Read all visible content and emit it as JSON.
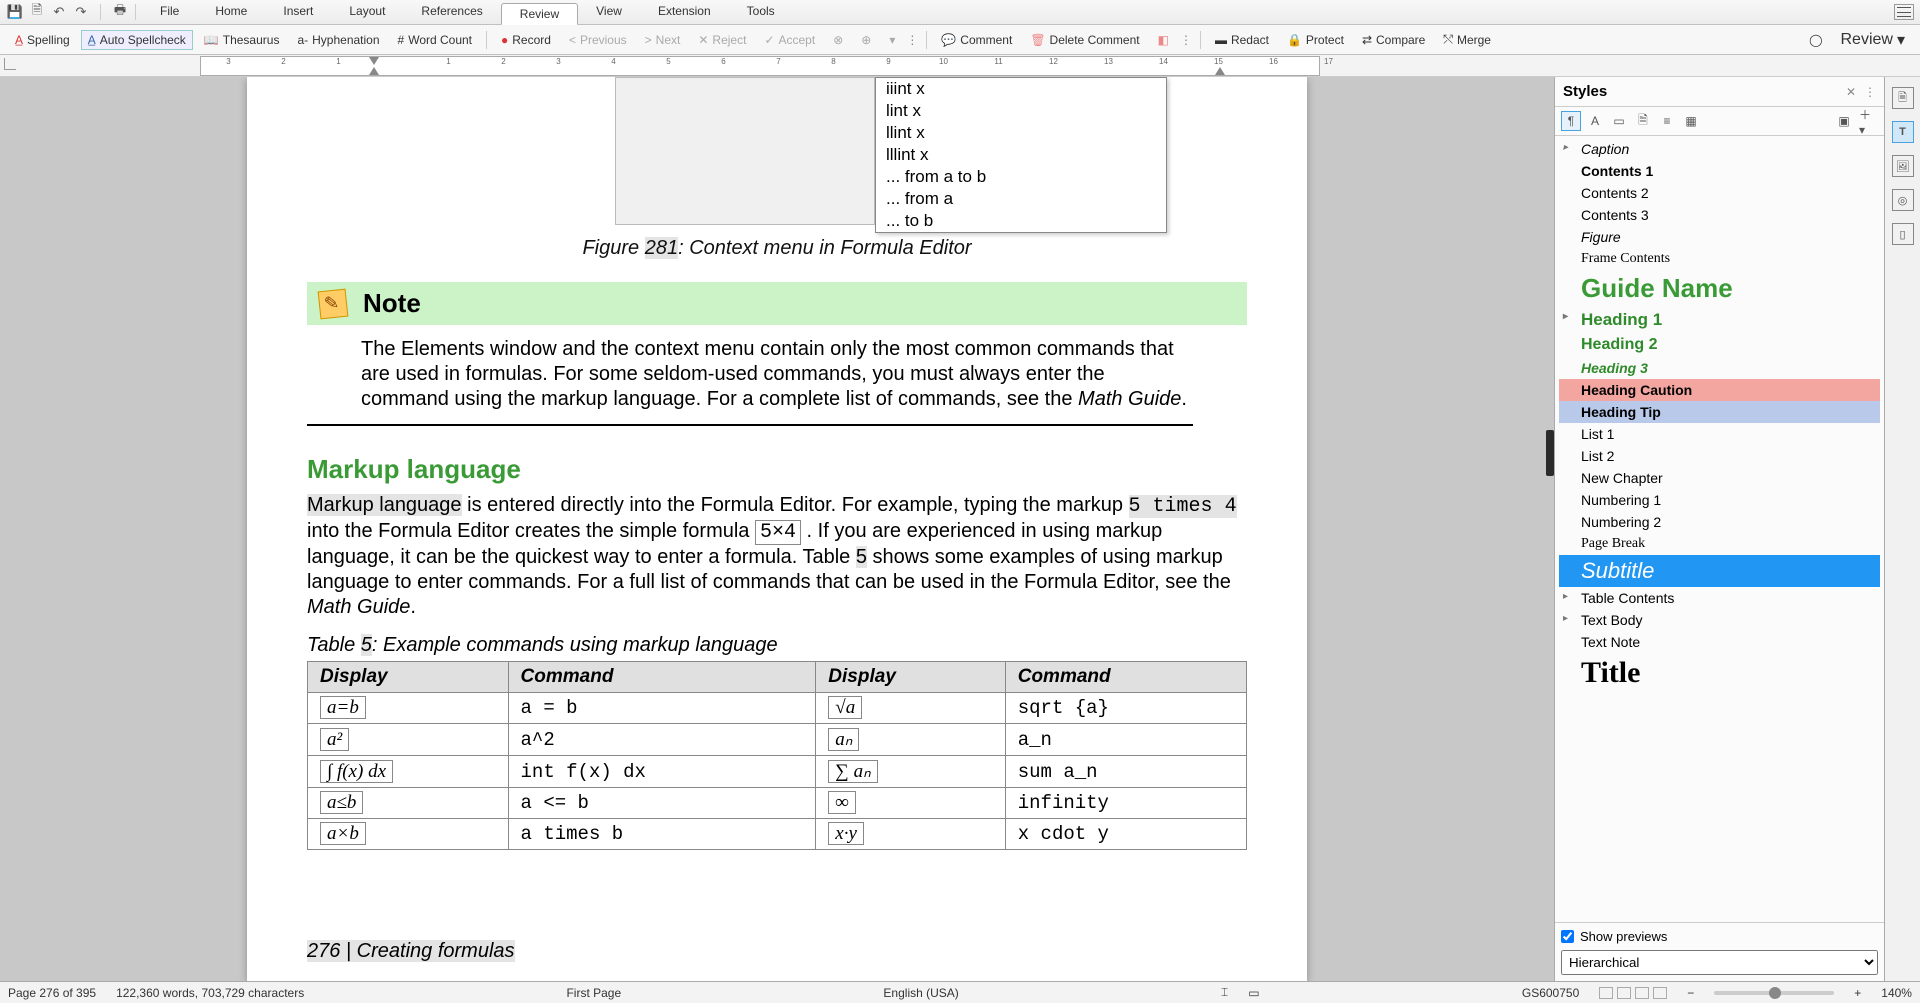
{
  "menus": [
    "File",
    "Home",
    "Insert",
    "Layout",
    "References",
    "Review",
    "View",
    "Extension",
    "Tools"
  ],
  "active_menu": 5,
  "toolbar": {
    "spelling": "Spelling",
    "auto_spellcheck": "Auto Spellcheck",
    "thesaurus": "Thesaurus",
    "hyphenation": "Hyphenation",
    "word_count": "Word Count",
    "record": "Record",
    "previous": "Previous",
    "next": "Next",
    "reject": "Reject",
    "accept": "Accept",
    "comment": "Comment",
    "delete_comment": "Delete Comment",
    "redact": "Redact",
    "protect": "Protect",
    "compare": "Compare",
    "merge": "Merge",
    "review": "Review"
  },
  "ruler_numbers": [
    "3",
    "2",
    "1",
    "",
    "1",
    "2",
    "3",
    "4",
    "5",
    "6",
    "7",
    "8",
    "9",
    "10",
    "11",
    "12",
    "13",
    "14",
    "15",
    "16",
    "17"
  ],
  "ctx_menu": {
    "items": [
      "iiint x",
      "lint x",
      "llint x",
      "lllint x",
      "... from a to b",
      "... from a",
      "... to b"
    ]
  },
  "figure_caption_pre": "Figure ",
  "figure_number": "281",
  "figure_caption_post": ": Context menu in Formula Editor",
  "note_title": "Note",
  "note_body_1": "The Elements window and the context menu contain only the most common commands that are used in formulas. For some seldom-used commands, you must always enter the command using the markup language. For a complete list of commands, see the ",
  "note_body_em": "Math Guide",
  "note_body_2": ".",
  "heading": "Markup language",
  "p1_a": "Markup language",
  "p1_b": " is entered directly into the Formula Editor. For example, typing the markup ",
  "p1_kbd": "5 times 4",
  "p1_c": " into the Formula Editor creates the simple formula ",
  "p1_fm": "5×4",
  "p1_d": " . If you are experienced in using markup language, it can be the quickest way to enter a formula. Table ",
  "p1_tnum": "5",
  "p1_e": " shows some examples of using markup language to enter commands. For a full list of commands that can be used in the Formula Editor, see the ",
  "p1_em": "Math Guide",
  "p1_f": ".",
  "table_caption_pre": "Table ",
  "table_number": "5",
  "table_caption_post": ": Example commands using markup language",
  "table": {
    "headers": [
      "Display",
      "Command",
      "Display",
      "Command"
    ],
    "rows": [
      {
        "d1": "a=b",
        "c1": "a = b",
        "d2": "√a",
        "c2": "sqrt {a}"
      },
      {
        "d1": "a²",
        "c1": "a^2",
        "d2": "aₙ",
        "c2": "a_n"
      },
      {
        "d1": "∫ f(x) dx",
        "c1": "int f(x) dx",
        "d2": "∑ aₙ",
        "c2": "sum a_n"
      },
      {
        "d1": "a≤b",
        "c1": "a <= b",
        "d2": "∞",
        "c2": "infinity"
      },
      {
        "d1": "a×b",
        "c1": "a times b",
        "d2": "x·y",
        "c2": "x cdot y"
      }
    ]
  },
  "page_footer_num": "276",
  "page_footer_txt": " | Creating formulas",
  "styles": {
    "title": "Styles",
    "list": [
      {
        "name": "Caption",
        "css": "font-style:italic;",
        "exp": true
      },
      {
        "name": "Contents 1",
        "css": "font-weight:bold;"
      },
      {
        "name": "Contents 2",
        "css": ""
      },
      {
        "name": "Contents 3",
        "css": ""
      },
      {
        "name": "Figure",
        "css": "font-style:italic;"
      },
      {
        "name": "Frame Contents",
        "css": "font-family:serif;"
      },
      {
        "name": "Guide Name",
        "css": "color:#3a9b36;font-size:26px;font-weight:bold;"
      },
      {
        "name": "Heading 1",
        "css": "color:#2e8a2a;font-weight:bold;font-size:17px;",
        "exp": true
      },
      {
        "name": "Heading 2",
        "css": "color:#2e8a2a;font-weight:bold;font-size:16px;"
      },
      {
        "name": "Heading 3",
        "css": "color:#2e8a2a;font-style:italic;font-weight:bold;"
      },
      {
        "name": "Heading Caution",
        "css": "background:#f3a6a0;font-weight:bold;"
      },
      {
        "name": "Heading Tip",
        "css": "background:#b9c9ea;font-weight:bold;"
      },
      {
        "name": "List 1",
        "css": ""
      },
      {
        "name": "List 2",
        "css": ""
      },
      {
        "name": "New Chapter",
        "css": ""
      },
      {
        "name": "Numbering 1",
        "css": ""
      },
      {
        "name": "Numbering 2",
        "css": ""
      },
      {
        "name": "Page Break",
        "css": "font-family:serif;"
      },
      {
        "name": "Subtitle",
        "css": "font-style:italic;font-size:22px;",
        "sel": true
      },
      {
        "name": "Table Contents",
        "css": "",
        "exp": true
      },
      {
        "name": "Text Body",
        "css": "",
        "exp": true
      },
      {
        "name": "Text Note",
        "css": ""
      },
      {
        "name": "Title",
        "css": "font-family:serif;font-size:30px;font-weight:bold;"
      }
    ],
    "show_previews": "Show previews",
    "filter": "Hierarchical"
  },
  "status": {
    "page": "Page 276 of 395",
    "words": "122,360 words, 703,729 characters",
    "style": "First Page",
    "lang": "English (USA)",
    "gs": "GS600750",
    "zoom": "140%"
  }
}
